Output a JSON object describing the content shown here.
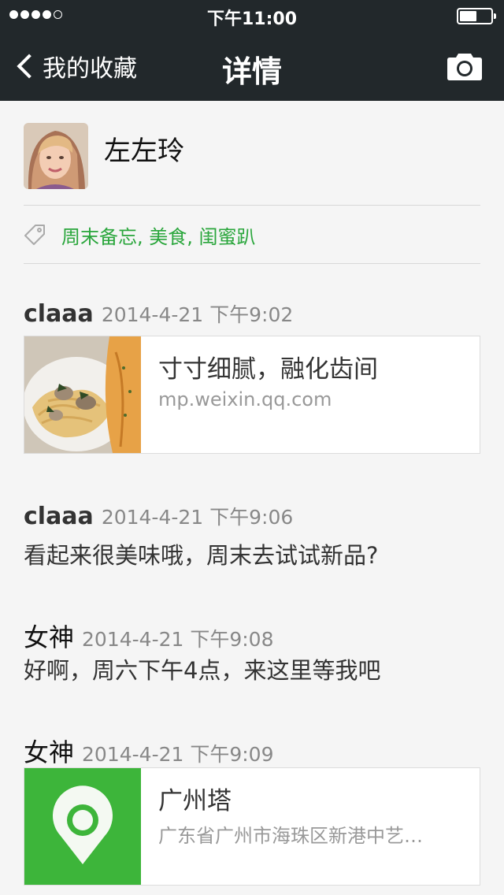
{
  "status_bar": {
    "time": "下午11:00",
    "battery_level": 0.55
  },
  "nav": {
    "back_label": "我的收藏",
    "title": "详情"
  },
  "profile": {
    "name": "左左玲"
  },
  "tags": {
    "text": "周末备忘, 美食, 闺蜜趴"
  },
  "entries": [
    {
      "author": "claaa",
      "time": "2014-4-21 下午9:02",
      "card": {
        "title": "寸寸细腻，融化齿间",
        "subtitle": "mp.weixin.qq.com"
      }
    },
    {
      "author": "claaa",
      "time": "2014-4-21 下午9:06",
      "text": "看起来很美味哦，周末去试试新品?"
    },
    {
      "author": "女神",
      "time": "2014-4-21 下午9:08",
      "text": "好啊，周六下午4点，来这里等我吧"
    },
    {
      "author": "女神",
      "time": "2014-4-21 下午9:09",
      "card": {
        "title": "广州塔",
        "subtitle": "广东省广州市海珠区新港中艺…"
      }
    }
  ],
  "colors": {
    "nav_bg": "#22282b",
    "tag_green": "#2aa63c",
    "location_green": "#3db53a"
  },
  "icons": [
    "back-chevron-icon",
    "camera-icon",
    "tag-icon",
    "location-pin-icon"
  ]
}
